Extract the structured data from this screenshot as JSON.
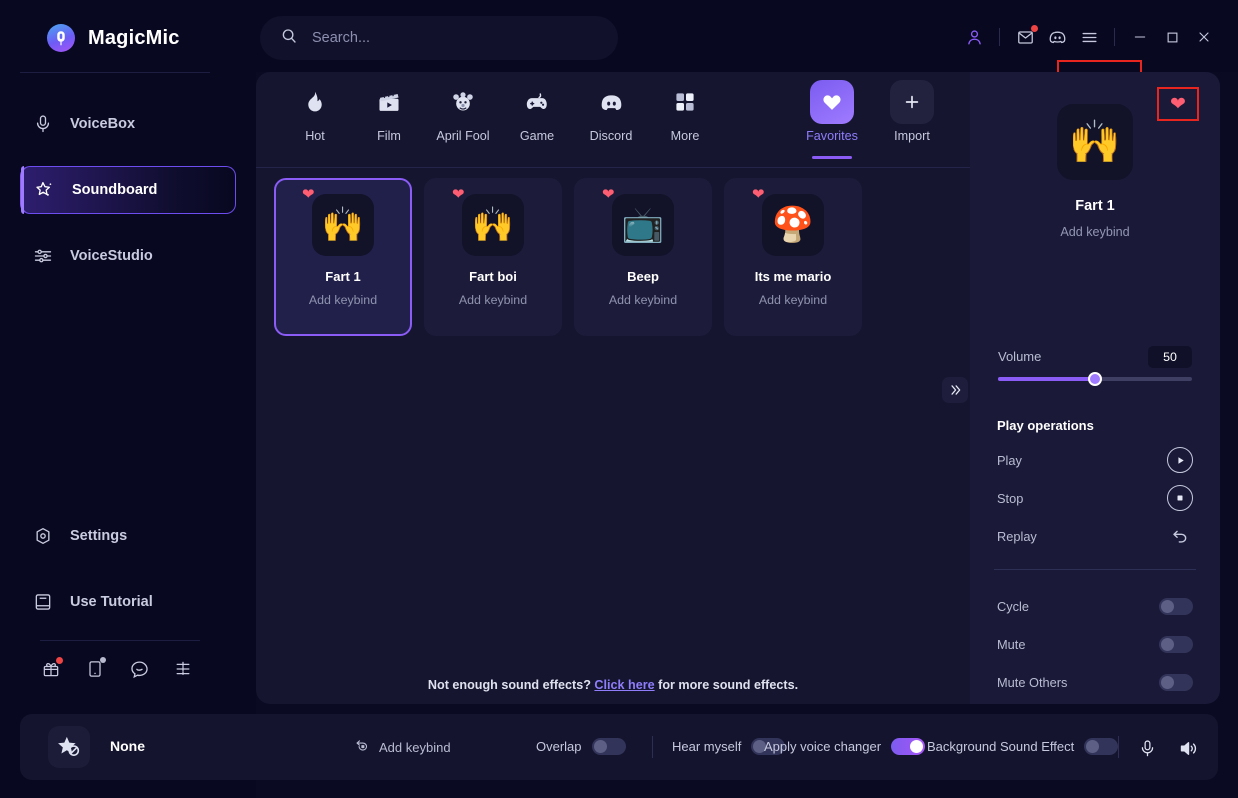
{
  "app": {
    "name": "MagicMic",
    "logo_icon": "magicmic-logo-icon"
  },
  "search": {
    "placeholder": "Search...",
    "value": "",
    "icon": "search-icon"
  },
  "titlebar": {
    "account_icon": "account-icon",
    "mail_icon": "mail-icon",
    "discord_icon": "discord-icon",
    "menu_icon": "hamburger-menu-icon",
    "minimize_icon": "minimize-icon",
    "maximize_icon": "maximize-icon",
    "close_icon": "close-icon"
  },
  "sidebar": {
    "items": [
      {
        "label": "VoiceBox",
        "icon": "microphone-icon",
        "active": false
      },
      {
        "label": "Soundboard",
        "icon": "sparkle-star-icon",
        "active": true
      },
      {
        "label": "VoiceStudio",
        "icon": "sliders-icon",
        "active": false
      }
    ],
    "bottom_items": [
      {
        "label": "Settings",
        "icon": "gear-icon"
      },
      {
        "label": "Use Tutorial",
        "icon": "book-icon"
      }
    ],
    "mini_icons": [
      {
        "name": "gift-box-icon",
        "badge": "red"
      },
      {
        "name": "mobile-device-icon",
        "badge": "grey"
      },
      {
        "name": "chat-bubble-icon",
        "badge": "none"
      },
      {
        "name": "feedback-icon",
        "badge": "none"
      }
    ]
  },
  "tabs": [
    {
      "label": "Hot",
      "icon": "flame-icon",
      "selected": false
    },
    {
      "label": "Film",
      "icon": "clapperboard-icon",
      "selected": false
    },
    {
      "label": "April Fool",
      "icon": "clown-icon",
      "selected": false
    },
    {
      "label": "Game",
      "icon": "gamepad-icon",
      "selected": false
    },
    {
      "label": "Discord",
      "icon": "discord-icon",
      "selected": false
    },
    {
      "label": "More",
      "icon": "grid-icon",
      "selected": false
    },
    {
      "label": "Favorites",
      "icon": "heart-icon",
      "selected": true,
      "highlighted": true
    },
    {
      "label": "Import",
      "icon": "plus-icon",
      "selected": false
    }
  ],
  "sounds": [
    {
      "name": "Fart 1",
      "keybind": "Add keybind",
      "emoji": "🙌",
      "favorite": true,
      "selected": true
    },
    {
      "name": "Fart boi",
      "keybind": "Add keybind",
      "emoji": "🙌",
      "favorite": true,
      "selected": false
    },
    {
      "name": "Beep",
      "keybind": "Add keybind",
      "emoji": "📺",
      "favorite": true,
      "selected": false
    },
    {
      "name": "Its me mario",
      "keybind": "Add keybind",
      "emoji": "🍄",
      "favorite": true,
      "selected": false
    }
  ],
  "main": {
    "collapse_icon": "double-chevron-right-icon",
    "footnote_pre": "Not enough sound effects?",
    "footnote_link": "Click here",
    "footnote_post": "for more sound effects."
  },
  "details": {
    "favorite_button_icon": "heart-filled-icon",
    "title": "Fart 1",
    "keybind": "Add keybind",
    "emoji": "🙌",
    "volume_label": "Volume",
    "volume_value": "50",
    "volume_percent": 50,
    "section_title": "Play operations",
    "operations": [
      {
        "label": "Play",
        "icon": "play-icon"
      },
      {
        "label": "Stop",
        "icon": "stop-icon"
      },
      {
        "label": "Replay",
        "icon": "replay-icon"
      }
    ],
    "toggles": [
      {
        "label": "Cycle",
        "on": false
      },
      {
        "label": "Mute",
        "on": false
      },
      {
        "label": "Mute Others",
        "on": false
      }
    ]
  },
  "bottom": {
    "avatar_icon": "star-disabled-icon",
    "voice_name": "None",
    "add_keybind_label": "Add keybind",
    "add_keybind_icon": "keybind-record-icon",
    "toggles": [
      {
        "label": "Overlap",
        "on": false
      },
      {
        "label": "Hear myself",
        "on": false
      },
      {
        "label": "Apply voice changer",
        "on": true
      },
      {
        "label": "Background Sound Effect",
        "on": false
      }
    ],
    "mic_icon": "microphone-icon",
    "speaker_icon": "speaker-icon"
  },
  "colors": {
    "accent": "#8b5cf6",
    "accent_light": "#9f7bff",
    "highlight_box": "#e8251f",
    "heart": "#ff5d72",
    "badge_red": "#ef4444",
    "bg_window": "#080820",
    "bg_main": "#15152f",
    "bg_right": "#1a1a38",
    "bg_card": "#1c1c3a"
  }
}
